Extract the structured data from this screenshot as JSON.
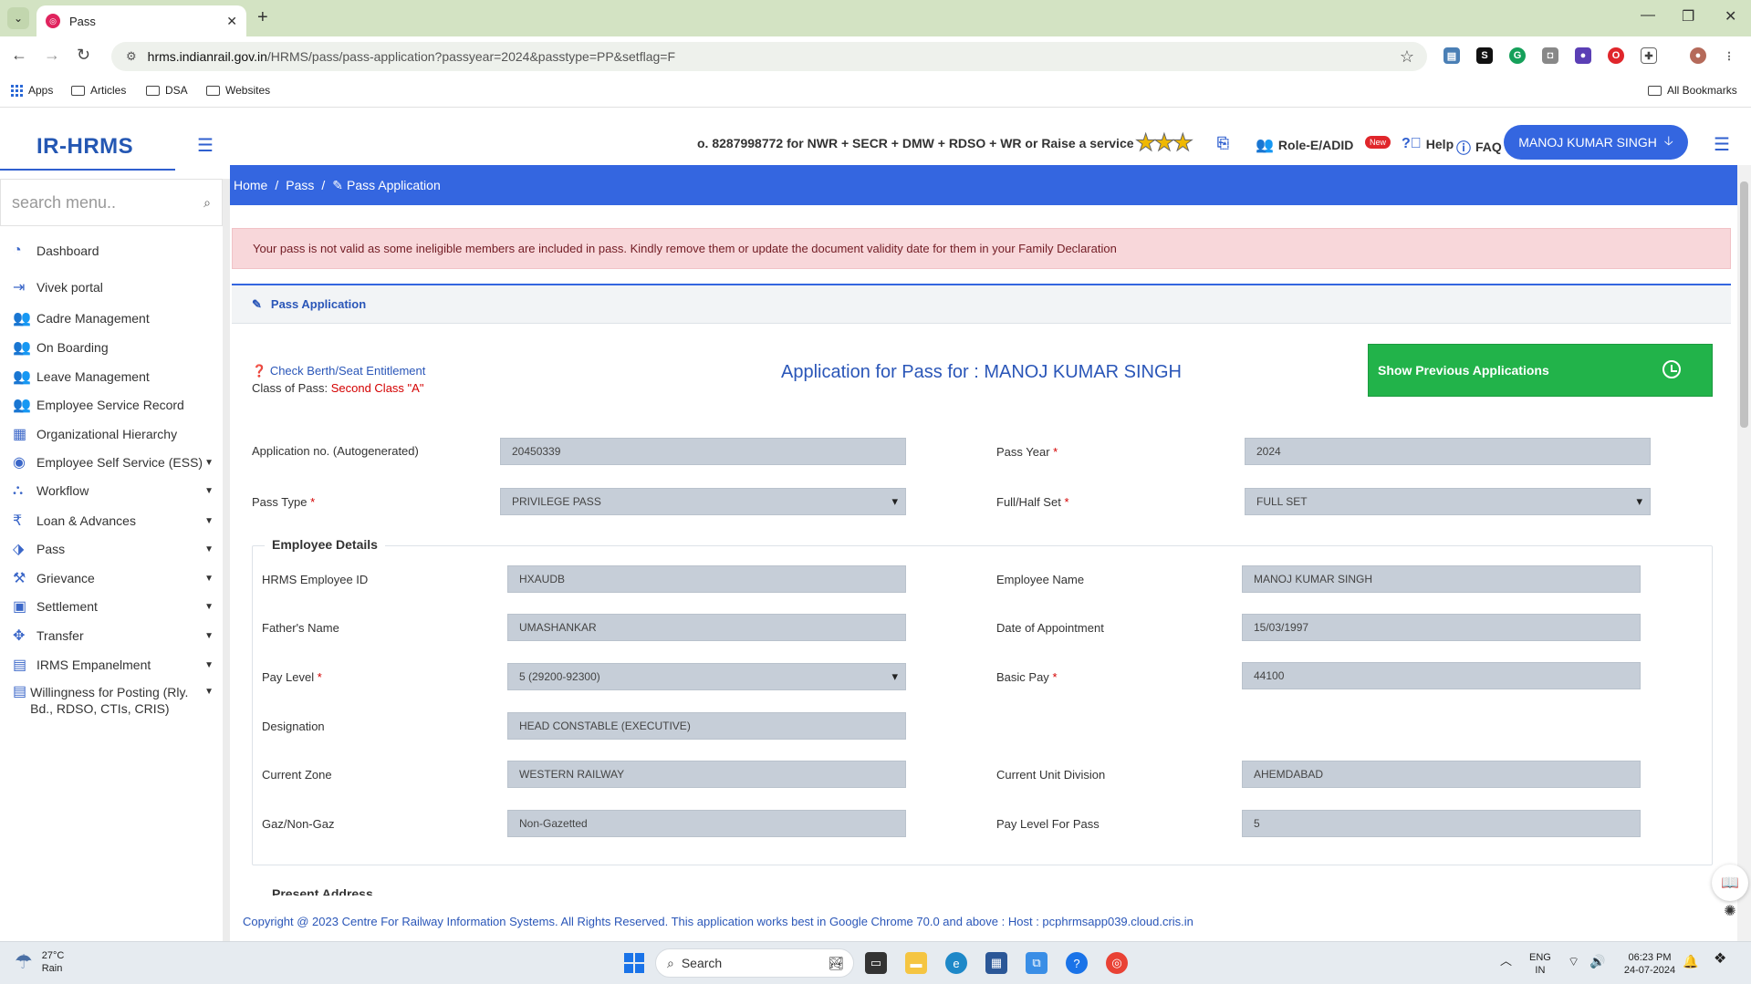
{
  "browser": {
    "tab_title": "Pass",
    "url_host": "hrms.indianrail.gov.in",
    "url_path": "/HRMS/pass/pass-application?passyear=2024&passtype=PP&setflag=F",
    "bookmarks": [
      "Apps",
      "Articles",
      "DSA",
      "Websites"
    ],
    "all_bookmarks": "All Bookmarks"
  },
  "header": {
    "logo": "IR-HRMS",
    "marquee": "o. 8287998772 for NWR + SECR + DMW + RDSO + WR or Raise a service request",
    "role": "Role-E/ADID",
    "new_badge": "New",
    "help": "Help",
    "faq": "FAQ",
    "user": "MANOJ KUMAR SINGH"
  },
  "sidebar": {
    "search_placeholder": "search menu..",
    "items": [
      {
        "label": "Dashboard",
        "icon": "dashboard-icon",
        "glyph": "◔",
        "has_caret": false
      },
      {
        "label": "Vivek portal",
        "icon": "login-icon",
        "glyph": "⇥",
        "has_caret": false
      },
      {
        "label": "Cadre Management",
        "icon": "users-icon",
        "glyph": "👥",
        "has_caret": false
      },
      {
        "label": "On Boarding",
        "icon": "users-icon",
        "glyph": "👥",
        "has_caret": false
      },
      {
        "label": "Leave Management",
        "icon": "users-icon",
        "glyph": "👥",
        "has_caret": false
      },
      {
        "label": "Employee Service Record",
        "icon": "users-icon",
        "glyph": "👥",
        "has_caret": false
      },
      {
        "label": "Organizational Hierarchy",
        "icon": "building-icon",
        "glyph": "▦",
        "has_caret": false
      },
      {
        "label": "Employee Self Service (ESS)",
        "icon": "user-icon",
        "glyph": "◉",
        "has_caret": true
      },
      {
        "label": "Workflow",
        "icon": "sitemap-icon",
        "glyph": "⛬",
        "has_caret": true
      },
      {
        "label": "Loan & Advances",
        "icon": "rupee-icon",
        "glyph": "₹",
        "has_caret": true
      },
      {
        "label": "Pass",
        "icon": "ticket-icon",
        "glyph": "⬗",
        "has_caret": true
      },
      {
        "label": "Grievance",
        "icon": "gavel-icon",
        "glyph": "⚒",
        "has_caret": true
      },
      {
        "label": "Settlement",
        "icon": "money-icon",
        "glyph": "▣",
        "has_caret": true
      },
      {
        "label": "Transfer",
        "icon": "arrows-icon",
        "glyph": "✥",
        "has_caret": true
      },
      {
        "label": "IRMS Empanelment",
        "icon": "list-icon",
        "glyph": "▤",
        "has_caret": true
      },
      {
        "label": "Willingness for Posting (Rly. Bd., RDSO, CTIs, CRIS)",
        "icon": "list-icon",
        "glyph": "▤",
        "has_caret": true
      }
    ]
  },
  "breadcrumb": [
    "Home",
    "/",
    "Pass",
    "/",
    "Pass Application"
  ],
  "alert": "Your pass is not valid as some ineligible members are included in pass. Kindly remove them or update the document validity date for them in your Family Declaration",
  "panel_title": "Pass Application",
  "entitlement_link": "Check Berth/Seat Entitlement",
  "class_label": "Class of Pass:",
  "class_value": "Second Class \"A\"",
  "app_title": "Application for Pass for : MANOJ KUMAR SINGH",
  "show_prev": "Show Previous Applications",
  "form": {
    "app_no_label": "Application no. (Autogenerated)",
    "app_no": "20450339",
    "pass_year_label": "Pass Year",
    "pass_year": "2024",
    "pass_type_label": "Pass Type",
    "pass_type": "PRIVILEGE PASS",
    "set_label": "Full/Half Set",
    "set_value": "FULL SET"
  },
  "employee": {
    "legend": "Employee Details",
    "hrms_id_label": "HRMS Employee ID",
    "hrms_id": "HXAUDB",
    "name_label": "Employee Name",
    "name": "MANOJ KUMAR SINGH",
    "father_label": "Father's Name",
    "father": "UMASHANKAR",
    "doa_label": "Date of Appointment",
    "doa": "15/03/1997",
    "pay_level_label": "Pay Level",
    "pay_level": "5 (29200-92300)",
    "basic_label": "Basic Pay",
    "basic": "44100",
    "designation_label": "Designation",
    "designation": "HEAD CONSTABLE (EXECUTIVE)",
    "zone_label": "Current Zone",
    "zone": "WESTERN RAILWAY",
    "division_label": "Current Unit Division",
    "division": "AHEMDABAD",
    "gaz_label": "Gaz/Non-Gaz",
    "gaz": "Non-Gazetted",
    "pl_pass_label": "Pay Level For Pass",
    "pl_pass": "5"
  },
  "next_legend": "Present Address",
  "footer": "Copyright @ 2023 Centre For Railway Information Systems. All Rights Reserved. This application works best in Google Chrome 70.0 and above : Host : pcphrmsapp039.cloud.cris.in",
  "taskbar": {
    "temp": "27°C",
    "weather": "Rain",
    "search": "Search",
    "lang1": "ENG",
    "lang2": "IN",
    "time": "06:23 PM",
    "date": "24-07-2024"
  }
}
